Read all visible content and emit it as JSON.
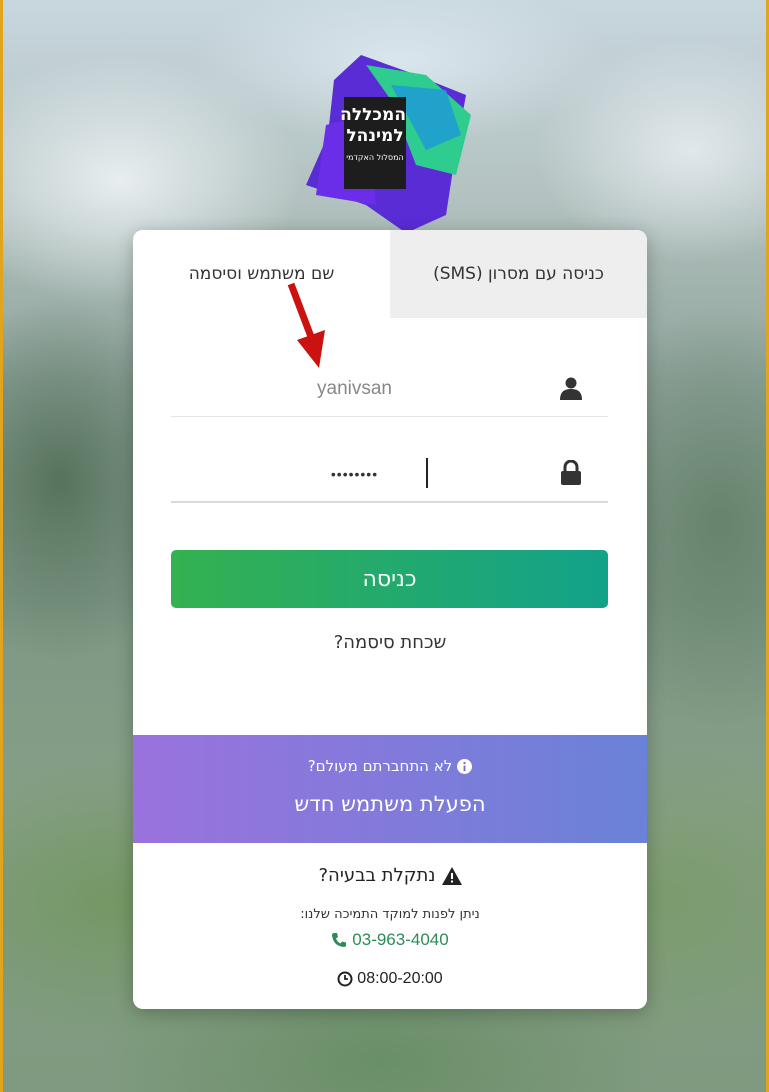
{
  "logo": {
    "line1": "המכללה",
    "line2": "למינהל",
    "line3": "המסלול האקדמי"
  },
  "tabs": {
    "sms_label": "כניסה עם מסרון (SMS)",
    "user_label": "שם משתמש וסיסמה"
  },
  "form": {
    "username_value": "yanivsan",
    "password_value": "••••••••",
    "login_label": "כניסה",
    "forgot_label": "שכחת סיסמה?"
  },
  "activate": {
    "question": "לא התחברתם מעולם?",
    "action_label": "הפעלת משתמש חדש"
  },
  "support": {
    "trouble_label": "נתקלת בבעיה?",
    "contact_text": "ניתן לפנות למוקד התמיכה שלנו:",
    "phone": "03-963-4040",
    "hours": "08:00-20:00"
  },
  "icons": {
    "user": "user-icon",
    "lock": "lock-icon",
    "info": "info-icon",
    "warning": "warning-icon",
    "phone": "phone-icon",
    "clock": "clock-icon"
  },
  "colors": {
    "login_button_start": "#34b150",
    "login_button_end": "#12a28a",
    "activate_start": "#9a72de",
    "activate_end": "#6a82d8",
    "phone_text": "#2e8b57",
    "annotation_arrow": "#cc1111"
  }
}
